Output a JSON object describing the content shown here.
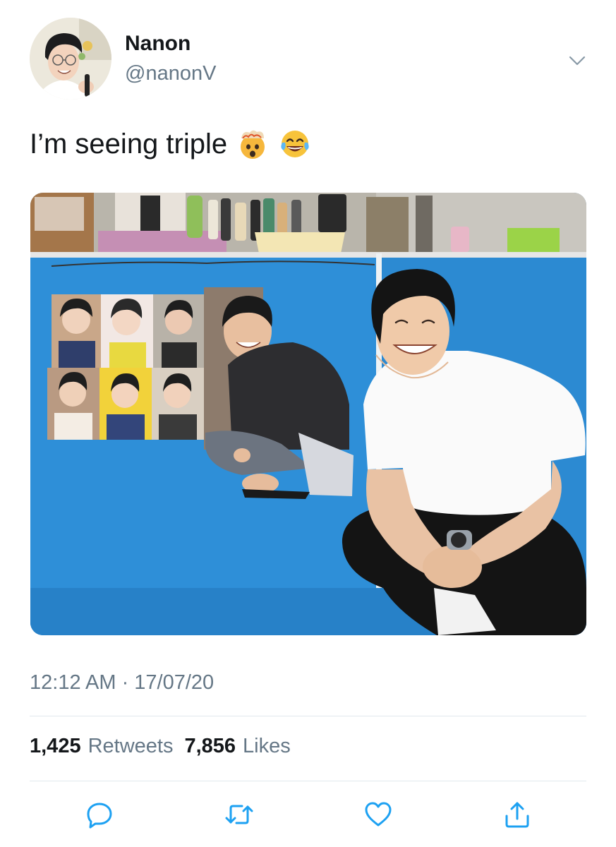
{
  "user": {
    "display_name": "Nanon",
    "handle": "@nanonV",
    "avatar_icon": "profile-photo"
  },
  "tweet": {
    "text": "I’m seeing triple",
    "emojis": [
      "exploding-head-emoji",
      "face-with-tears-of-joy-emoji"
    ],
    "timestamp": "12:12 AM · 17/07/20"
  },
  "stats": {
    "retweets_count": "1,425",
    "retweets_label": "Retweets",
    "likes_count": "7,856",
    "likes_label": "Likes"
  },
  "actions": {
    "reply_icon": "reply-icon",
    "retweet_icon": "retweet-icon",
    "like_icon": "heart-icon",
    "share_icon": "share-icon"
  },
  "colors": {
    "text_primary": "#14171a",
    "text_secondary": "#657786",
    "icon_color": "#1da1f2",
    "divider": "#e1e8ed"
  }
}
